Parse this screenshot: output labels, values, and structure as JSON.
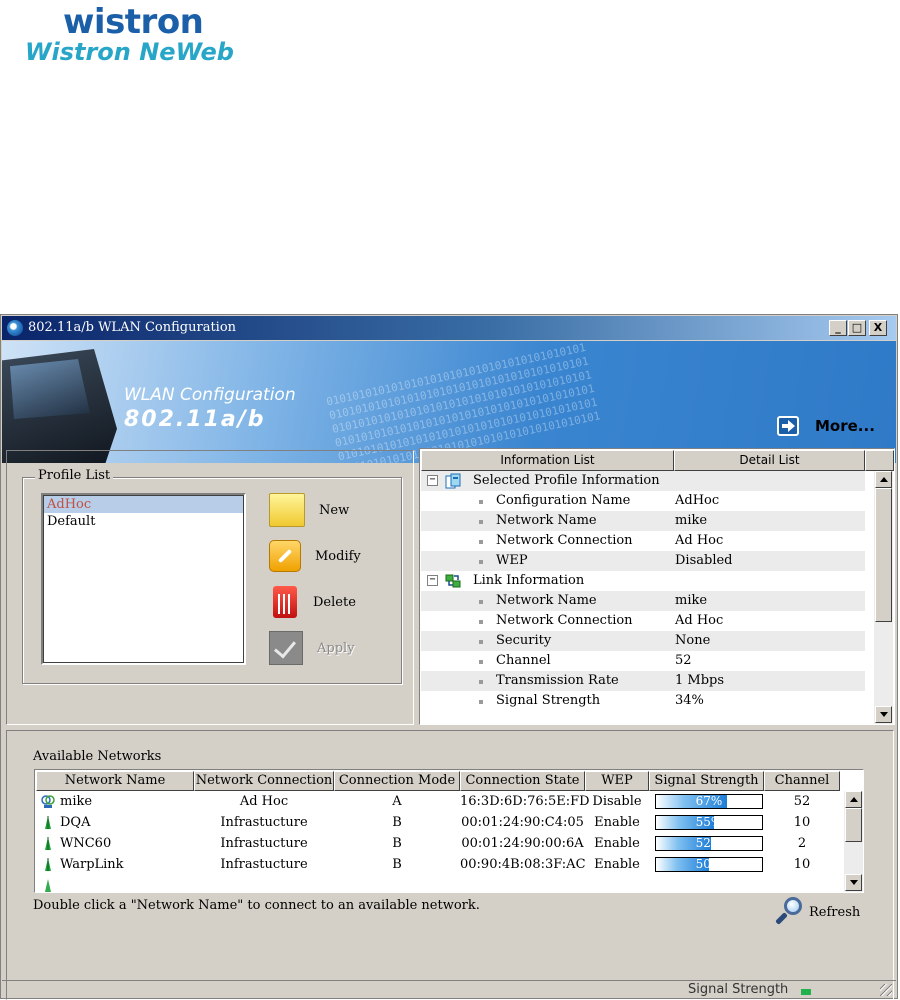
{
  "logo": {
    "line1": "wistron",
    "line2": "Wistron NeWeb"
  },
  "window": {
    "title": "802.11a/b WLAN Configuration",
    "buttons": {
      "minimize": "_",
      "maximize": "□",
      "close": "X"
    }
  },
  "banner": {
    "line1": "WLAN Configuration",
    "line2": "802.11a/b",
    "more_label": "More...",
    "binary": "0101010101010101010101010101010101010101"
  },
  "profile": {
    "group_label": "Profile List",
    "items": [
      {
        "label": "AdHoc",
        "selected": true
      },
      {
        "label": "Default",
        "selected": false
      }
    ],
    "actions": {
      "new": "New",
      "modify": "Modify",
      "delete": "Delete",
      "apply": "Apply"
    }
  },
  "info_panel": {
    "tabs": {
      "information": "Information List",
      "detail": "Detail List"
    },
    "selected_section": "Selected Profile Information",
    "selected_rows": [
      {
        "label": "Configuration Name",
        "value": "AdHoc"
      },
      {
        "label": "Network Name",
        "value": "mike"
      },
      {
        "label": "Network Connection",
        "value": "Ad Hoc"
      },
      {
        "label": "WEP",
        "value": "Disabled"
      }
    ],
    "link_section": "Link Information",
    "link_rows": [
      {
        "label": "Network Name",
        "value": "mike"
      },
      {
        "label": "Network Connection",
        "value": "Ad Hoc"
      },
      {
        "label": "Security",
        "value": "None"
      },
      {
        "label": "Channel",
        "value": "52"
      },
      {
        "label": "Transmission Rate",
        "value": "1 Mbps"
      },
      {
        "label": "Signal Strength",
        "value": "34%"
      }
    ],
    "expander_glyph": "−"
  },
  "networks": {
    "title": "Available Networks",
    "columns": [
      "Network Name",
      "Network Connection",
      "Connection Mode",
      "Connection State",
      "WEP",
      "Signal Strength",
      "Channel"
    ],
    "rows": [
      {
        "name": "mike",
        "connection": "Ad Hoc",
        "mode": "A",
        "state": "16:3D:6D:76:5E:FD",
        "wep": "Disable",
        "signal": 67,
        "signal_label": "67%",
        "channel": "52",
        "icon": "adhoc-icon"
      },
      {
        "name": "DQA",
        "connection": "Infrastucture",
        "mode": "B",
        "state": "00:01:24:90:C4:05",
        "wep": "Enable",
        "signal": 55,
        "signal_label": "55%",
        "channel": "10",
        "icon": "access-point-icon"
      },
      {
        "name": "WNC60",
        "connection": "Infrastucture",
        "mode": "B",
        "state": "00:01:24:90:00:6A",
        "wep": "Enable",
        "signal": 52,
        "signal_label": "52%",
        "channel": "2",
        "icon": "access-point-icon"
      },
      {
        "name": "WarpLink",
        "connection": "Infrastucture",
        "mode": "B",
        "state": "00:90:4B:08:3F:AC",
        "wep": "Enable",
        "signal": 50,
        "signal_label": "50%",
        "channel": "10",
        "icon": "access-point-icon"
      }
    ],
    "hint": "Double click a \"Network Name\" to connect to an available network.",
    "refresh_label": "Refresh"
  },
  "status_bar": {
    "label": "Signal Strength",
    "bars_on": 1,
    "bars_total": 2
  },
  "colors": {
    "title_start": "#0a246a",
    "accent": "#1b5fa8",
    "signal_fill": "#1e7ed8",
    "selected_row": "#b7cde8"
  }
}
